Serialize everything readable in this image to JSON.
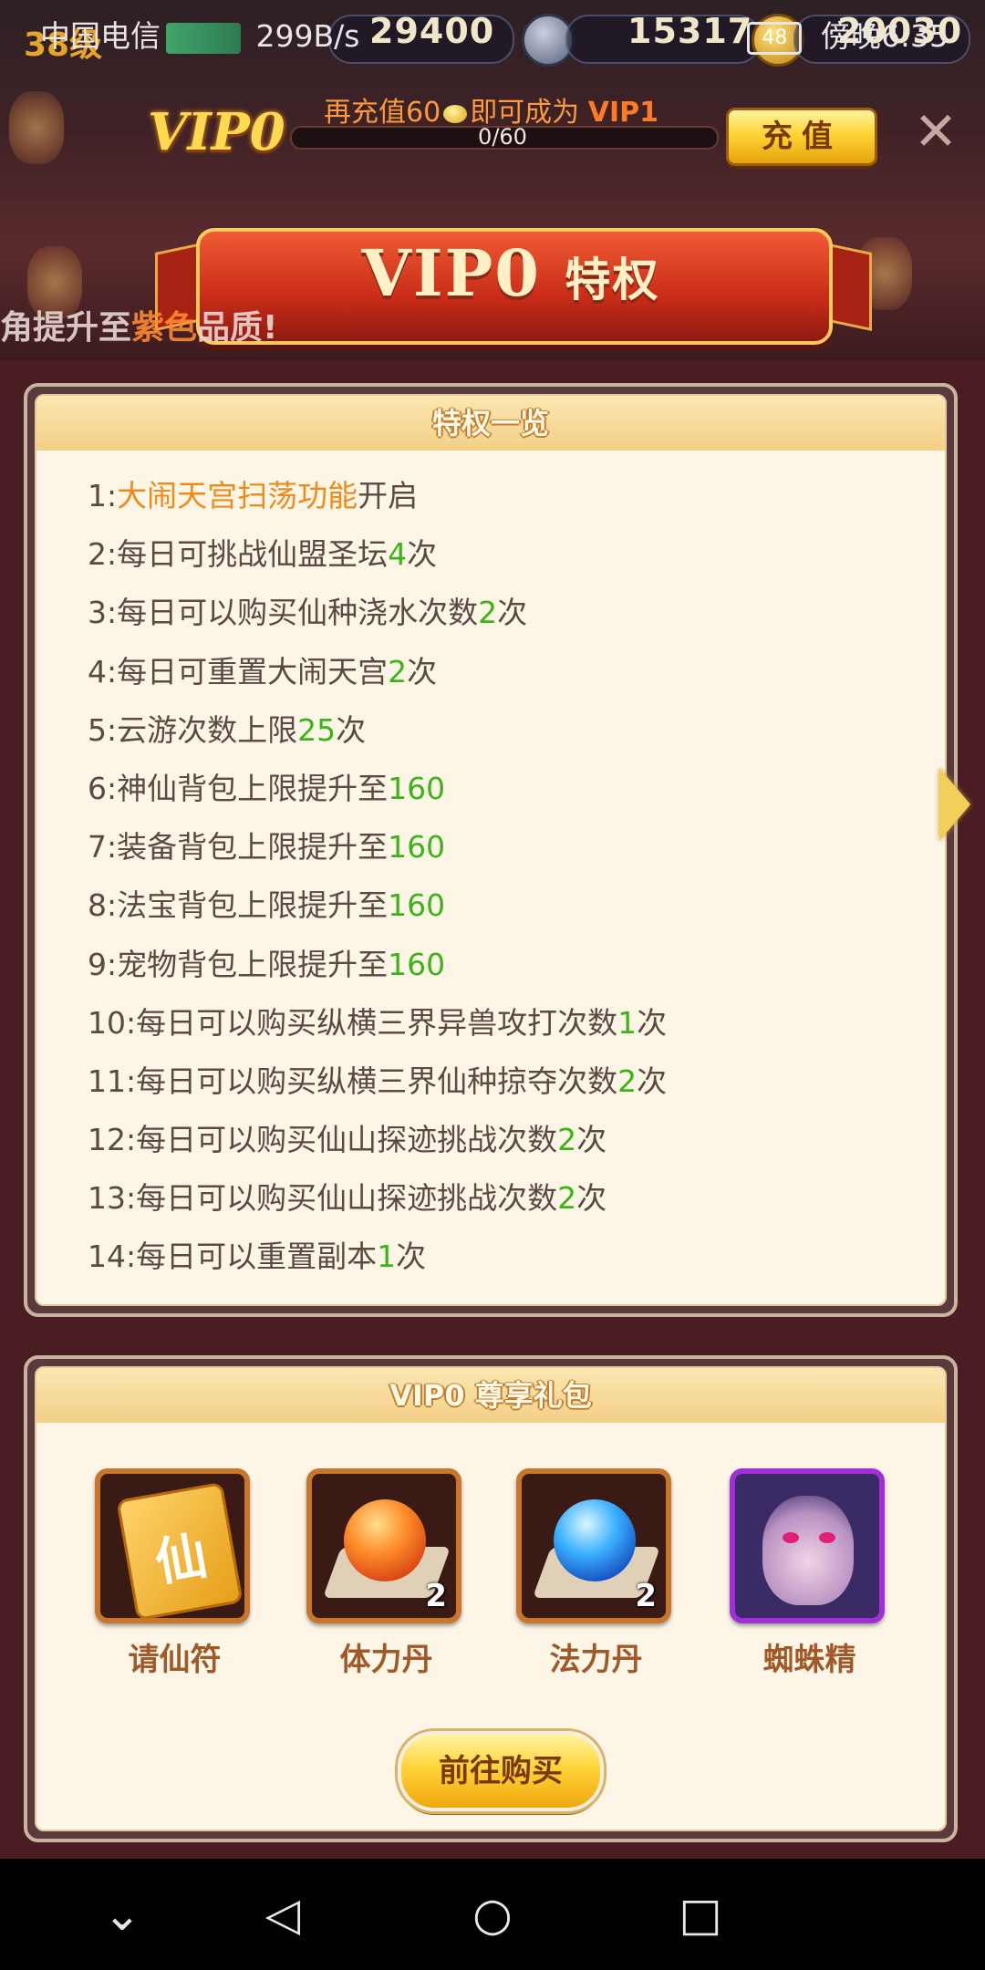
{
  "status_bar": {
    "carrier": "中国电信",
    "speed": "299B/s",
    "battery": "48",
    "time": "傍晚6:35"
  },
  "game_header": {
    "level": "38级",
    "silver": "29400",
    "power": "15317",
    "gold": "20030"
  },
  "vip": {
    "current_level": "VIP0",
    "recharge_prefix": "再充值60",
    "recharge_mid": "即可成为",
    "next_level": "VIP1",
    "progress_text": "0/60",
    "progress_fraction": 0,
    "charge_button": "充值",
    "close_icon": "✕"
  },
  "banner": {
    "title": "VIP0",
    "title_suffix": "特权",
    "marquee_prefix": "角提升至",
    "marquee_highlight": "紫色",
    "marquee_suffix": "品质!"
  },
  "privileges": {
    "header": "特权一览",
    "items": [
      {
        "prefix": "1:",
        "highlight": "大闹天宫扫荡功能",
        "suffix": "开启"
      },
      {
        "prefix": "2:每日可挑战仙盟圣坛",
        "num": "4",
        "suffix": "次"
      },
      {
        "prefix": "3:每日可以购买仙种浇水次数",
        "num": "2",
        "suffix": "次"
      },
      {
        "prefix": "4:每日可重置大闹天宫",
        "num": "2",
        "suffix": "次"
      },
      {
        "prefix": "5:云游次数上限",
        "num": "25",
        "suffix": "次"
      },
      {
        "prefix": "6:神仙背包上限提升至",
        "num": "160",
        "suffix": ""
      },
      {
        "prefix": "7:装备背包上限提升至",
        "num": "160",
        "suffix": ""
      },
      {
        "prefix": "8:法宝背包上限提升至",
        "num": "160",
        "suffix": ""
      },
      {
        "prefix": "9:宠物背包上限提升至",
        "num": "160",
        "suffix": ""
      },
      {
        "prefix": "10:每日可以购买纵横三界异兽攻打次数",
        "num": "1",
        "suffix": "次"
      },
      {
        "prefix": "11:每日可以购买纵横三界仙种掠夺次数",
        "num": "2",
        "suffix": "次"
      },
      {
        "prefix": "12:每日可以购买仙山探迹挑战次数",
        "num": "2",
        "suffix": "次"
      },
      {
        "prefix": "13:每日可以购买仙山探迹挑战次数",
        "num": "2",
        "suffix": "次"
      },
      {
        "prefix": "14:每日可以重置副本",
        "num": "1",
        "suffix": "次"
      }
    ]
  },
  "gift_pack": {
    "header": "VIP0  尊享礼包",
    "items": [
      {
        "name": "请仙符",
        "count": "",
        "icon": "immortal-talisman-icon"
      },
      {
        "name": "体力丹",
        "count": "2",
        "icon": "stamina-pill-icon"
      },
      {
        "name": "法力丹",
        "count": "2",
        "icon": "mana-pill-icon"
      },
      {
        "name": "蜘蛛精",
        "count": "",
        "icon": "spider-spirit-portrait"
      }
    ],
    "fu_char": "仙",
    "buy_button": "前往购买"
  },
  "nav": {
    "down": "⌄",
    "back": "◁",
    "home": "○",
    "recent": "□"
  },
  "colors": {
    "accent_gold": "#ffd434",
    "highlight_green": "#3cb418",
    "highlight_orange": "#f08a1a",
    "panel_bg": "#fdf5e6",
    "page_bg": "#4a1d22"
  }
}
